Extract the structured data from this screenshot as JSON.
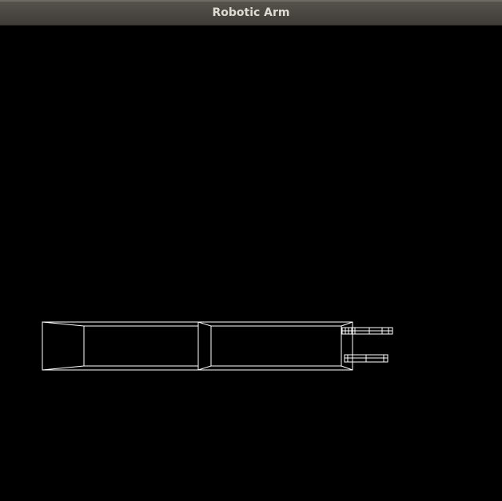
{
  "window": {
    "title": "Robotic Arm"
  },
  "scene": {
    "render_mode": "wireframe",
    "background_color": "#000000",
    "line_color": "#ffffff",
    "components": [
      "base-segment",
      "upper-arm-segment",
      "gripper-finger-upper",
      "gripper-finger-lower"
    ]
  }
}
